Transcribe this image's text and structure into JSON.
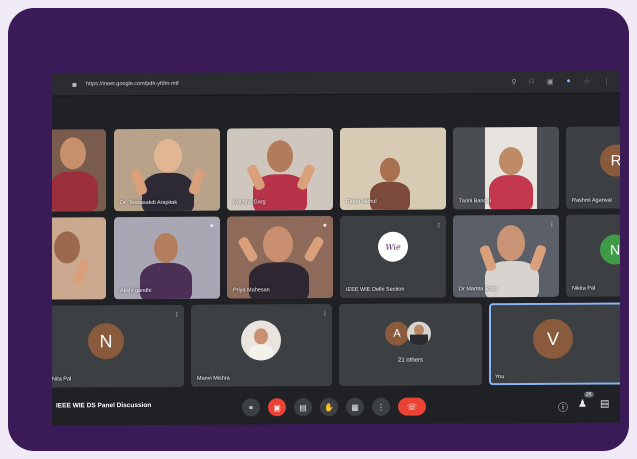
{
  "browser": {
    "url": "https://meet.google.com/pdh-yfdm-mtf"
  },
  "tiles": [
    {
      "name": ""
    },
    {
      "name": "Dr. Tessasakdi Arapitak"
    },
    {
      "name": "Rachna Garg"
    },
    {
      "name": "Ekata Mehul"
    },
    {
      "name": "Tarini Bandal"
    },
    {
      "name": "Rashmi Agarwal",
      "initial": "R"
    },
    {
      "name": ""
    },
    {
      "name": "Akshi gandhi"
    },
    {
      "name": "Priya Mahesan"
    },
    {
      "name": "IEEE WIE Delhi Section",
      "logo_text": "Wie"
    },
    {
      "name": "Dr Mamta Bhan"
    },
    {
      "name": "Nikita Pal",
      "initial": "N"
    },
    {
      "name": "Nita Pal",
      "initial": "N"
    },
    {
      "name": "Manvi Mishra"
    },
    {
      "name": "21 others",
      "initial": "A"
    },
    {
      "name": "You",
      "initial": "V"
    }
  ],
  "meeting": {
    "title": "IEEE WIE DS Panel Discussion"
  },
  "controls": {
    "mic_icon": "microphone-icon",
    "cam_off_icon": "camera-off-icon",
    "cc_icon": "captions-icon",
    "hand_icon": "raise-hand-icon",
    "present_icon": "present-icon",
    "more_icon": "more-options-icon",
    "leave_icon": "end-call-icon",
    "info_icon": "info-icon",
    "people_icon": "people-icon",
    "people_count": "26",
    "chat_icon": "chat-icon"
  },
  "colors": {
    "card_bg": "#3b1a58",
    "meet_bg": "#202124",
    "leave_red": "#ea4335",
    "you_border": "#8ab4f8",
    "avatar_brown": "#8a5a3c",
    "avatar_green": "#3f9b46"
  }
}
